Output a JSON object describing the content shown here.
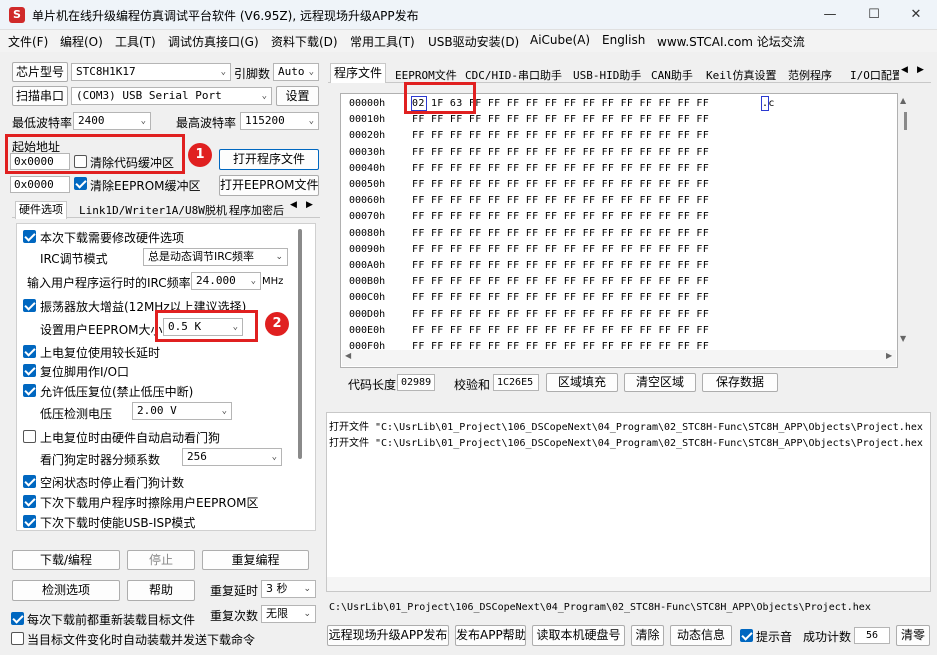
{
  "window": {
    "title": "单片机在线升级编程仿真调试平台软件 (V6.95Z), 远程现场升级APP发布",
    "icon_label": "S"
  },
  "menu": [
    "文件(F)",
    "编程(O)",
    "工具(T)",
    "调试仿真接口(G)",
    "资料下载(D)",
    "常用工具(T)",
    "USB驱动安装(D)",
    "AiCube(A)",
    "English",
    "www.STCAI.com 论坛交流"
  ],
  "left": {
    "chip_label": "芯片型号",
    "chip_value": "STC8H1K17",
    "pin_label": "引脚数",
    "pin_value": "Auto",
    "scan_button": "扫描串口",
    "port_value": "(COM3) USB Serial Port",
    "settings_button": "设置",
    "min_baud_label": "最低波特率",
    "min_baud_value": "2400",
    "max_baud_label": "最高波特率",
    "max_baud_value": "115200",
    "start_addr_label": "起始地址",
    "start_addr_value": "0x0000",
    "clear_code_label": "清除代码缓冲区",
    "open_prog_button": "打开程序文件",
    "eeprom_addr_value": "0x0000",
    "clear_eeprom_label": "清除EEPROM缓冲区",
    "open_eeprom_button": "打开EEPROM文件",
    "tabs": [
      "硬件选项",
      "Link1D/Writer1A/U8W脱机",
      "程序加密后"
    ],
    "hw": {
      "opt_modify": "本次下载需要修改硬件选项",
      "irc_mode_label": "IRC调节模式",
      "irc_mode_value": "总是动态调节IRC频率",
      "irc_freq_label": "输入用户程序运行时的IRC频率",
      "irc_freq_value": "24.000",
      "irc_freq_unit": "MHz",
      "osc_gain": "振荡器放大增益(12MHz以上建议选择)",
      "eeprom_size_label": "设置用户EEPROM大小",
      "eeprom_size_value": "0.5 K",
      "power_delay": "上电复位使用较长延时",
      "reset_io": "复位脚用作I/O口",
      "lvd_reset": "允许低压复位(禁止低压中断)",
      "lvd_voltage_label": "低压检测电压",
      "lvd_voltage_value": "2.00 V",
      "wdt_auto": "上电复位时由硬件自动启动看门狗",
      "wdt_div_label": "看门狗定时器分频系数",
      "wdt_div_value": "256",
      "idle_wdt": "空闲状态时停止看门狗计数",
      "erase_eeprom": "下次下载用户程序时擦除用户EEPROM区",
      "usb_isp": "下次下载时使能USB-ISP模式"
    },
    "download_button": "下载/编程",
    "stop_button": "停止",
    "reprogram_button": "重复编程",
    "detect_button": "检测选项",
    "help_button": "帮助",
    "repeat_delay_label": "重复延时",
    "repeat_delay_value": "3 秒",
    "repeat_count_label": "重复次数",
    "repeat_count_value": "无限",
    "reload_label": "每次下载前都重新装载目标文件",
    "auto_send_label": "当目标文件变化时自动装载并发送下载命令"
  },
  "right": {
    "tabs": [
      "程序文件",
      "EEPROM文件",
      "CDC/HID-串口助手",
      "USB-HID助手",
      "CAN助手",
      "Keil仿真设置",
      "范例程序",
      "I/O口配置"
    ],
    "hex_rows": [
      {
        "addr": "00000h",
        "data": "02 1F 63 FF FF FF FF FF FF FF FF FF FF FF FF FF",
        "ascii": ".c"
      },
      {
        "addr": "00010h",
        "data": "FF FF FF FF FF FF FF FF FF FF FF FF FF FF FF FF"
      },
      {
        "addr": "00020h",
        "data": "FF FF FF FF FF FF FF FF FF FF FF FF FF FF FF FF"
      },
      {
        "addr": "00030h",
        "data": "FF FF FF FF FF FF FF FF FF FF FF FF FF FF FF FF"
      },
      {
        "addr": "00040h",
        "data": "FF FF FF FF FF FF FF FF FF FF FF FF FF FF FF FF"
      },
      {
        "addr": "00050h",
        "data": "FF FF FF FF FF FF FF FF FF FF FF FF FF FF FF FF"
      },
      {
        "addr": "00060h",
        "data": "FF FF FF FF FF FF FF FF FF FF FF FF FF FF FF FF"
      },
      {
        "addr": "00070h",
        "data": "FF FF FF FF FF FF FF FF FF FF FF FF FF FF FF FF"
      },
      {
        "addr": "00080h",
        "data": "FF FF FF FF FF FF FF FF FF FF FF FF FF FF FF FF"
      },
      {
        "addr": "00090h",
        "data": "FF FF FF FF FF FF FF FF FF FF FF FF FF FF FF FF"
      },
      {
        "addr": "000A0h",
        "data": "FF FF FF FF FF FF FF FF FF FF FF FF FF FF FF FF"
      },
      {
        "addr": "000B0h",
        "data": "FF FF FF FF FF FF FF FF FF FF FF FF FF FF FF FF"
      },
      {
        "addr": "000C0h",
        "data": "FF FF FF FF FF FF FF FF FF FF FF FF FF FF FF FF"
      },
      {
        "addr": "000D0h",
        "data": "FF FF FF FF FF FF FF FF FF FF FF FF FF FF FF FF"
      },
      {
        "addr": "000E0h",
        "data": "FF FF FF FF FF FF FF FF FF FF FF FF FF FF FF FF"
      },
      {
        "addr": "000F0h",
        "data": "FF FF FF FF FF FF FF FF FF FF FF FF FF FF FF FF"
      }
    ],
    "code_len_label": "代码长度",
    "code_len_value": "02989",
    "checksum_label": "校验和",
    "checksum_value": "1C26E5",
    "fill_button": "区域填充",
    "clear_area_button": "清空区域",
    "save_button": "保存数据",
    "log": [
      "打开文件 \"C:\\UsrLib\\01_Project\\106_DSCopeNext\\04_Program\\02_STC8H-Func\\STC8H_APP\\Objects\\Project.hex",
      "打开文件 \"C:\\UsrLib\\01_Project\\106_DSCopeNext\\04_Program\\02_STC8H-Func\\STC8H_APP\\Objects\\Project.hex"
    ],
    "path": "C:\\UsrLib\\01_Project\\106_DSCopeNext\\04_Program\\02_STC8H-Func\\STC8H_APP\\Objects\\Project.hex",
    "remote_button": "远程现场升级APP发布",
    "publish_help_button": "发布APP帮助",
    "read_serial_button": "读取本机硬盘号",
    "clear_button": "清除",
    "dynamic_button": "动态信息",
    "sound_label": "提示音",
    "success_label": "成功计数",
    "success_value": "56",
    "clear_count_button": "清零"
  },
  "annotations": {
    "one": "1",
    "two": "2"
  },
  "colors": {
    "annotation_red": "#e02020",
    "checkbox_blue": "#0067c0"
  }
}
